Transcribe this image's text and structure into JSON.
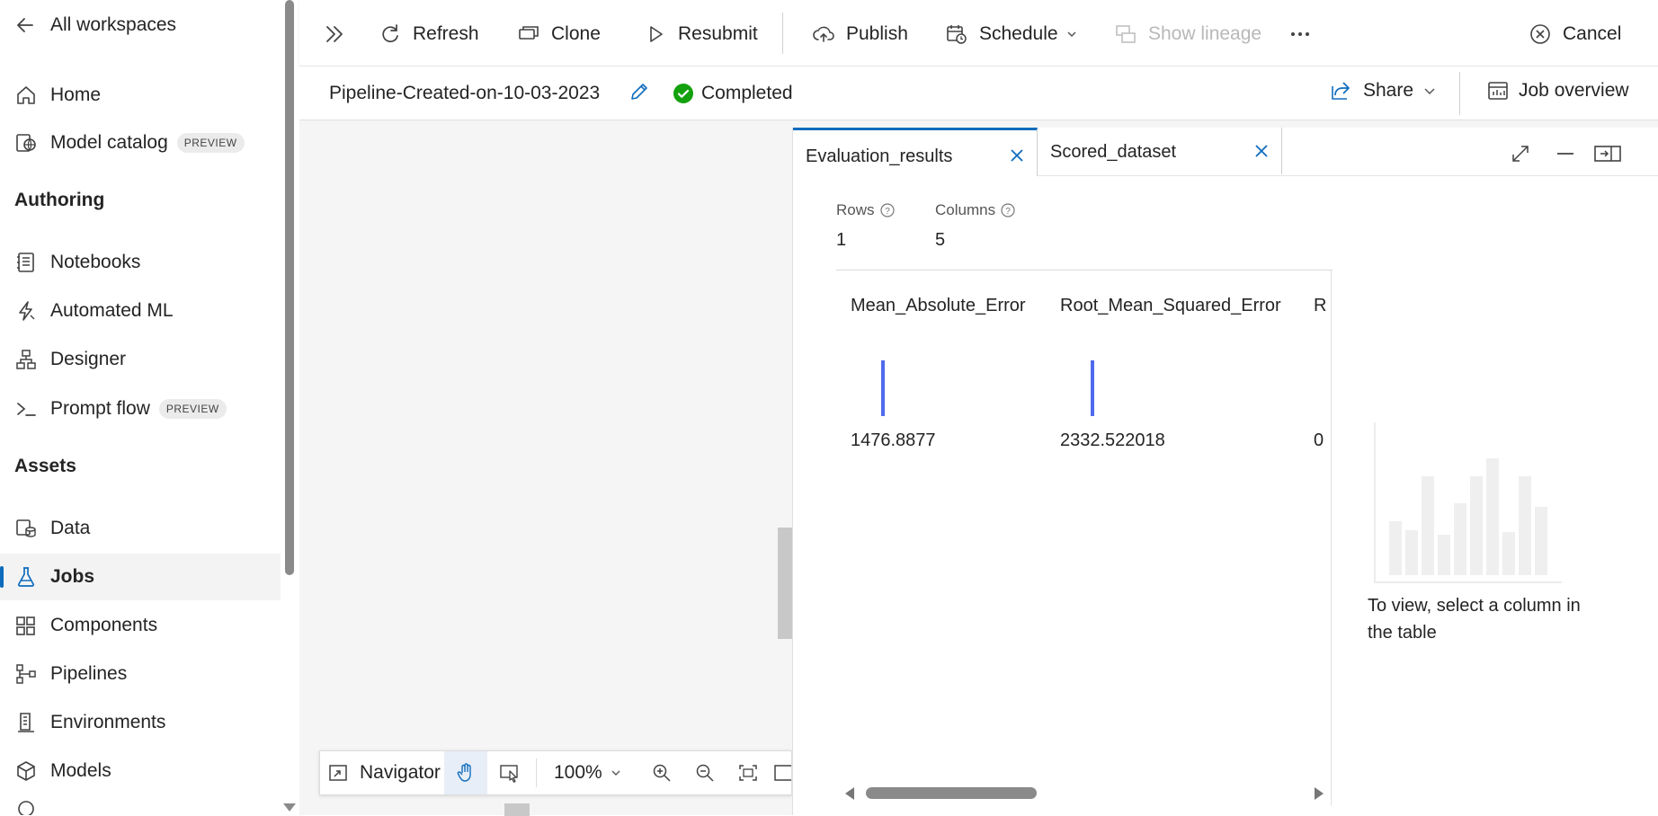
{
  "sidebar": {
    "back_label": "All workspaces",
    "items": [
      {
        "label": "Home",
        "icon": "home-icon"
      },
      {
        "label": "Model catalog",
        "badge": "PREVIEW",
        "icon": "globe-book-icon"
      }
    ],
    "authoring_title": "Authoring",
    "authoring_items": [
      {
        "label": "Notebooks",
        "icon": "notebook-icon"
      },
      {
        "label": "Automated ML",
        "icon": "flash-icon"
      },
      {
        "label": "Designer",
        "icon": "flow-diagram-icon"
      },
      {
        "label": "Prompt flow",
        "badge": "PREVIEW",
        "icon": "terminal-icon"
      }
    ],
    "assets_title": "Assets",
    "assets_items": [
      {
        "label": "Data",
        "icon": "database-icon"
      },
      {
        "label": "Jobs",
        "icon": "flask-icon",
        "active": true
      },
      {
        "label": "Components",
        "icon": "grid-add-icon"
      },
      {
        "label": "Pipelines",
        "icon": "branch-icon"
      },
      {
        "label": "Environments",
        "icon": "building-icon"
      },
      {
        "label": "Models",
        "icon": "cube-icon"
      }
    ]
  },
  "toolbar": {
    "refresh": "Refresh",
    "clone": "Clone",
    "resubmit": "Resubmit",
    "publish": "Publish",
    "schedule": "Schedule",
    "show_lineage": "Show lineage",
    "cancel": "Cancel"
  },
  "job": {
    "title": "Pipeline-Created-on-10-03-2023",
    "status": "Completed",
    "share": "Share",
    "job_overview": "Job overview"
  },
  "navigator": {
    "label": "Navigator",
    "zoom": "100%"
  },
  "panel": {
    "tabs": [
      {
        "label": "Evaluation_results",
        "active": true
      },
      {
        "label": "Scored_dataset",
        "active": false
      }
    ],
    "rows_label": "Rows",
    "rows_value": "1",
    "columns_label": "Columns",
    "columns_value": "5",
    "table": {
      "columns": [
        {
          "header": "Mean_Absolute_Error",
          "value": "1476.8877"
        },
        {
          "header": "Root_Mean_Squared_Error",
          "value": "2332.522018"
        },
        {
          "header": "R",
          "value": "0"
        }
      ]
    },
    "empty_hint": "To view, select a column in the table"
  },
  "colors": {
    "accent": "#0f6cbd",
    "success": "#13a10e",
    "histogram_bar": "#4f6bed"
  }
}
